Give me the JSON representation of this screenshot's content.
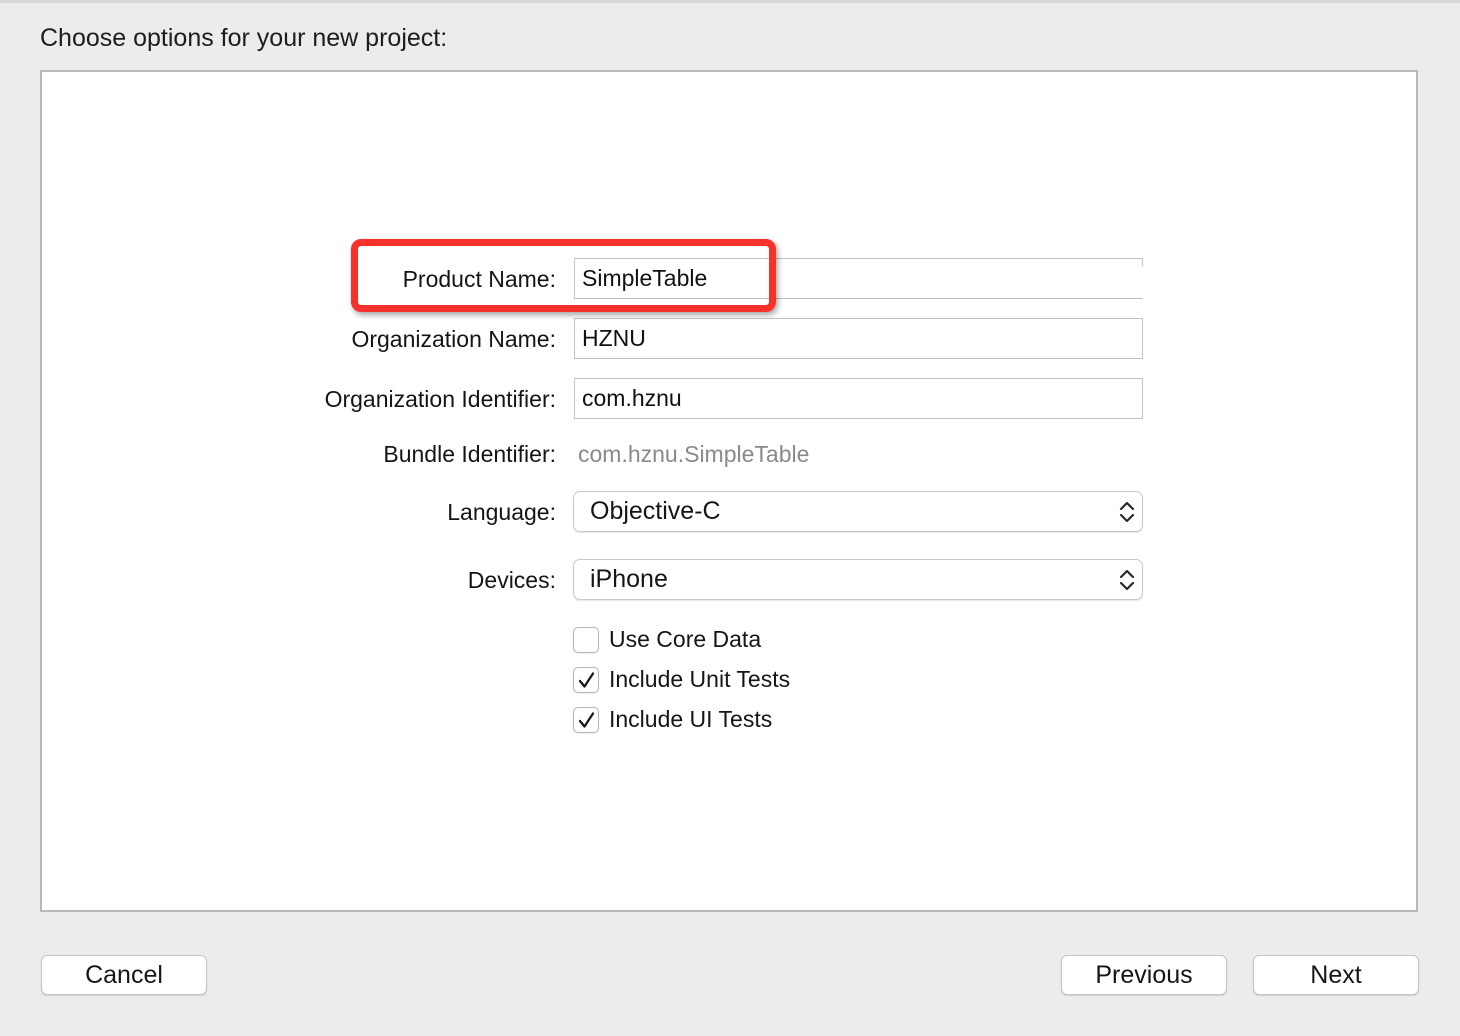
{
  "header": {
    "title": "Choose options for your new project:"
  },
  "form": {
    "product_name": {
      "label": "Product Name:",
      "value": "SimpleTable"
    },
    "organization_name": {
      "label": "Organization Name:",
      "value": "HZNU"
    },
    "organization_identifier": {
      "label": "Organization Identifier:",
      "value": "com.hznu"
    },
    "bundle_identifier": {
      "label": "Bundle Identifier:",
      "value": "com.hznu.SimpleTable"
    },
    "language": {
      "label": "Language:",
      "selected": "Objective-C"
    },
    "devices": {
      "label": "Devices:",
      "selected": "iPhone"
    },
    "checkboxes": [
      {
        "label": "Use Core Data",
        "checked": false
      },
      {
        "label": "Include Unit Tests",
        "checked": true
      },
      {
        "label": "Include UI Tests",
        "checked": true
      }
    ]
  },
  "footer": {
    "cancel_label": "Cancel",
    "previous_label": "Previous",
    "next_label": "Next"
  },
  "colors": {
    "highlight": "#f5312a",
    "background": "#ececec",
    "panel": "#ffffff"
  },
  "icons": {
    "popup_arrows": "chevron-up-down-icon",
    "checkmark": "checkmark-icon"
  }
}
